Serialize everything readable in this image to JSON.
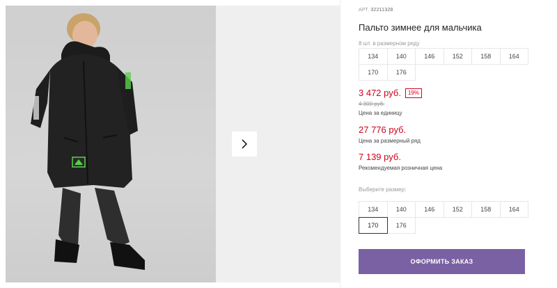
{
  "product": {
    "sku_label": "АРТ.",
    "sku_value": "32211328",
    "title": "Пальто зимнее для мальчика",
    "range_info": "8 шт. в размерном ряду"
  },
  "size_range": [
    "134",
    "140",
    "146",
    "152",
    "158",
    "164",
    "170",
    "176"
  ],
  "pricing": {
    "unit_price": "3 472 руб.",
    "discount": "19%",
    "old_price": "4 300 руб.",
    "unit_caption": "Цена за единицу",
    "range_price": "27 776 руб.",
    "range_caption": "Цена за размерный ряд",
    "retail_price": "7 139 руб.",
    "retail_caption": "Рекомендуемая розничная цена"
  },
  "size_selector": {
    "label": "Выберите размер:",
    "options": [
      "134",
      "140",
      "146",
      "152",
      "158",
      "164",
      "170",
      "176"
    ],
    "selected": "170"
  },
  "order_button": "ОФОРМИТЬ ЗАКАЗ",
  "icons": {
    "next": "chevron-right-icon"
  },
  "colors": {
    "accent_button": "#7a61a3",
    "price_red": "#d0021b"
  }
}
